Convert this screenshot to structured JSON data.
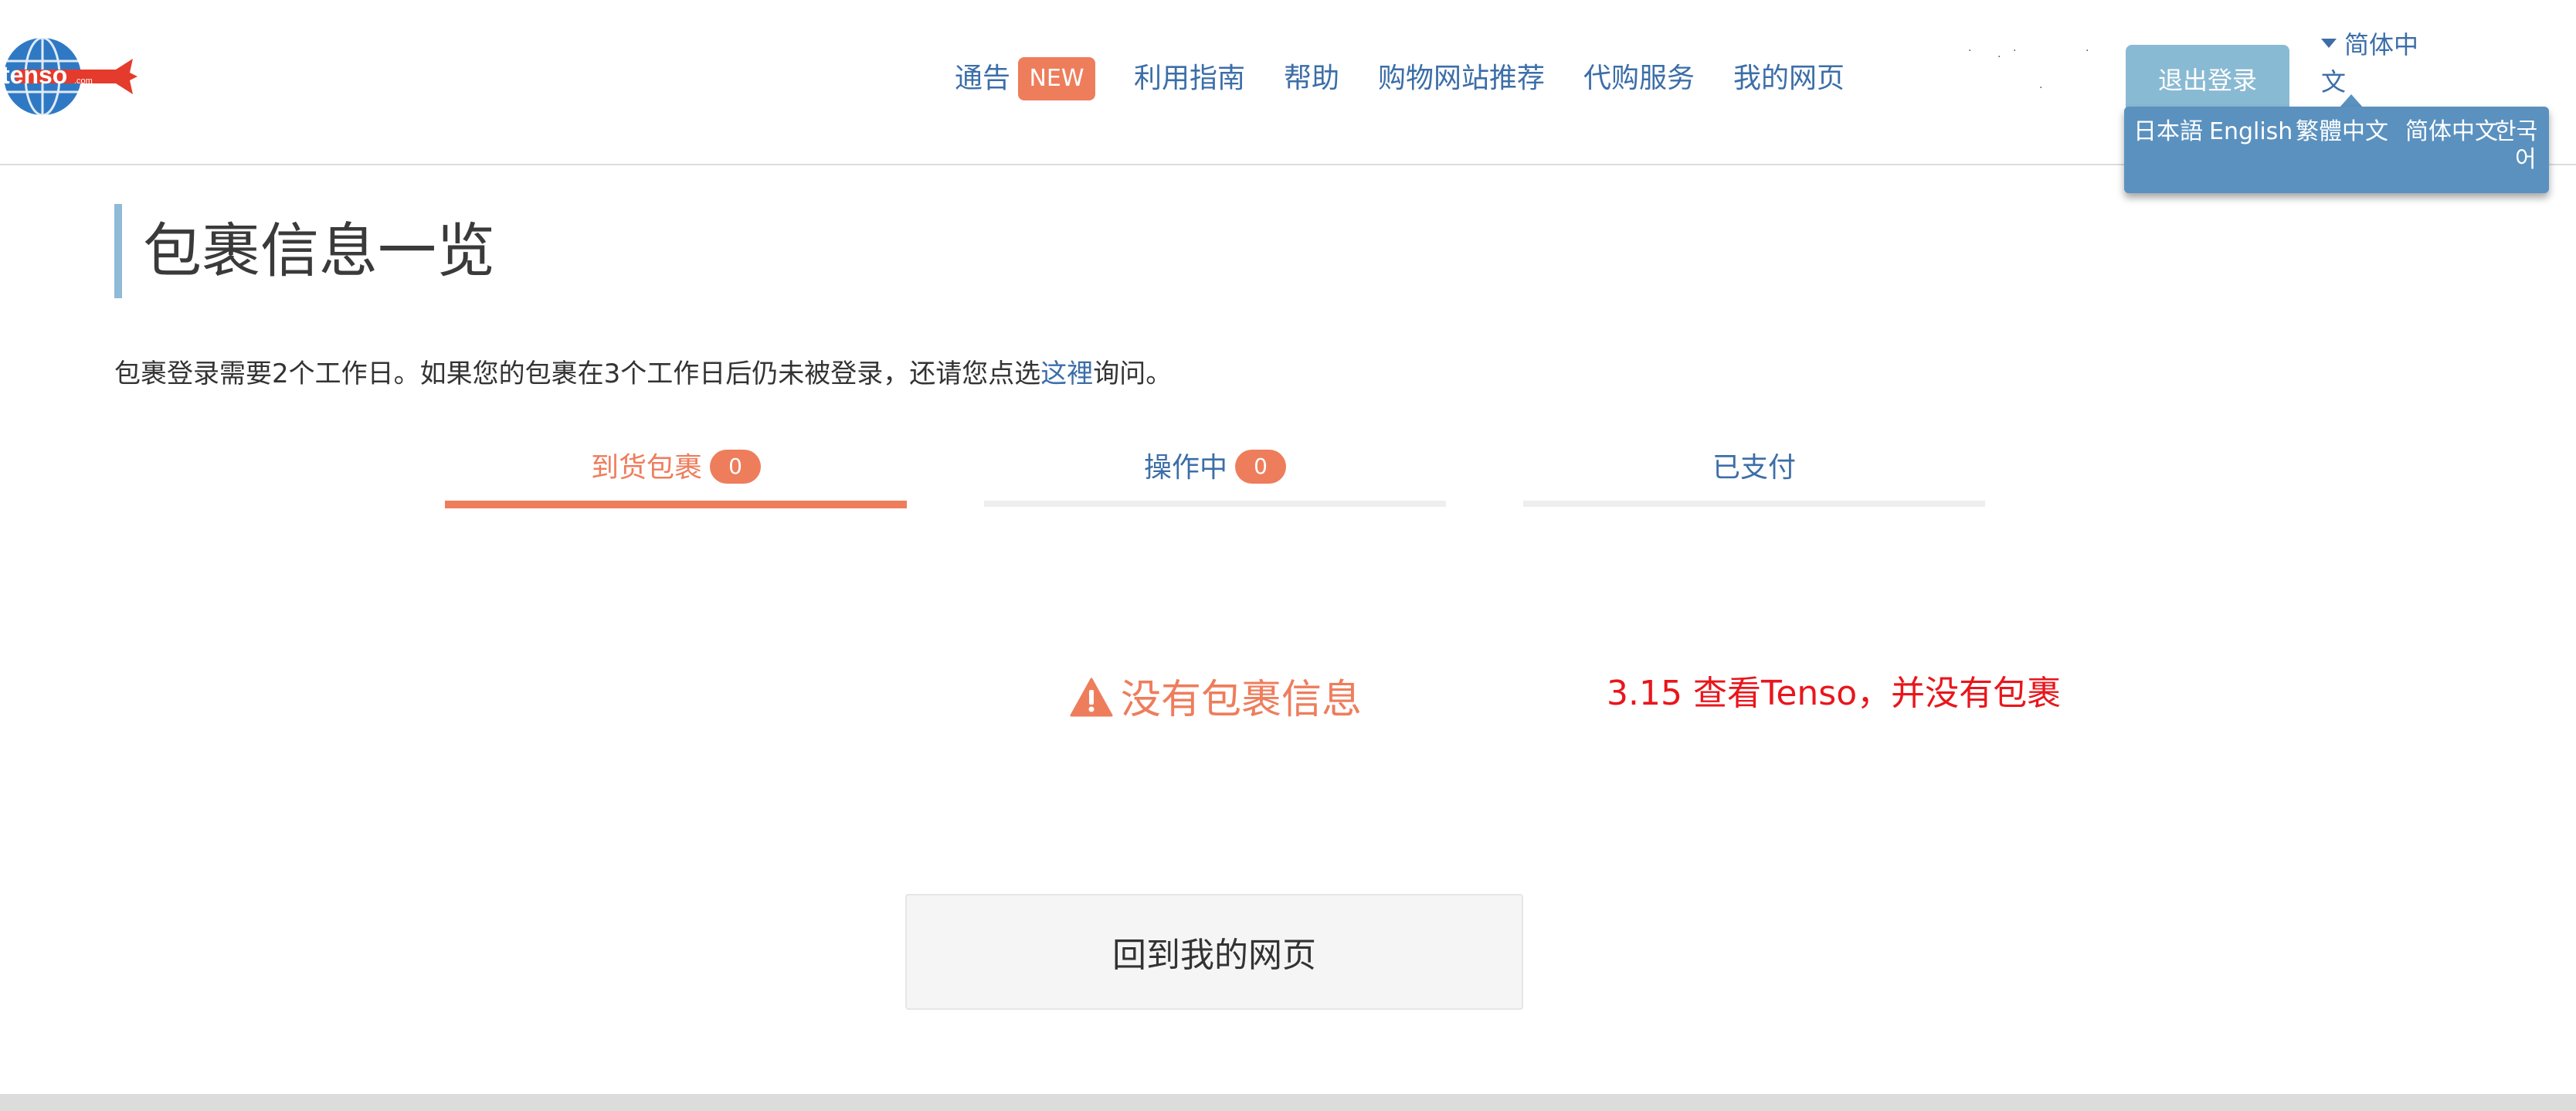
{
  "header": {
    "logo_text": "tenso",
    "logo_suffix": ".com",
    "nav": [
      {
        "label": "通告"
      },
      {
        "label": "利用指南"
      },
      {
        "label": "帮助"
      },
      {
        "label": "购物网站推荐"
      },
      {
        "label": "代购服务"
      },
      {
        "label": "我的网页"
      }
    ],
    "new_badge": "NEW",
    "logout_label": "退出登录",
    "current_language_line1": "简体中",
    "current_language_line2": "文",
    "languages": [
      "日本語",
      "English",
      "繁體中文",
      "简体中文",
      "한국",
      "어"
    ]
  },
  "page": {
    "title": "包裹信息一览",
    "notice_before": "包裹登录需要2个工作日。如果您的包裹在3个工作日后仍未被登录，还请您点选",
    "notice_link": "这裡",
    "notice_after": "询问。"
  },
  "tabs": [
    {
      "label": "到货包裹",
      "count": "0",
      "active": true
    },
    {
      "label": "操作中",
      "count": "0",
      "active": false
    },
    {
      "label": "已支付",
      "count": "",
      "active": false
    }
  ],
  "empty_state": {
    "icon": "warning-icon",
    "text": "没有包裹信息"
  },
  "annotation": "3.15 查看Tenso，并没有包裹",
  "back_button_label": "回到我的网页",
  "colors": {
    "accent": "#ee7d5c",
    "link": "#3c6ea8",
    "logout_bg": "#89bad3",
    "dropdown_bg": "#5a91bf",
    "annotation": "#e8161c",
    "title_bar": "#8fbad8"
  }
}
